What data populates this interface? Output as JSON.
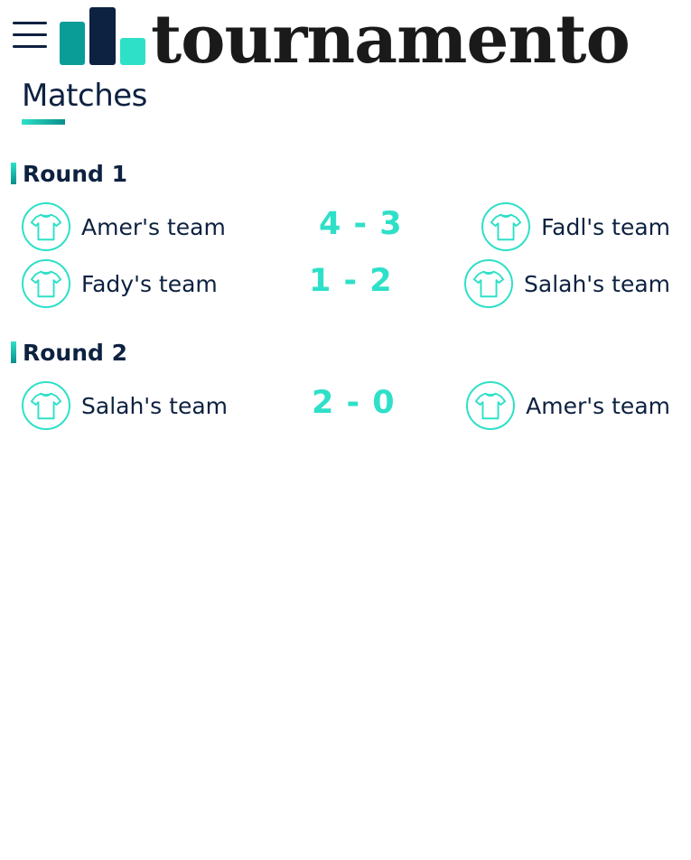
{
  "app": {
    "logo_text": "tournamento",
    "colors": {
      "navy": "#0d2140",
      "teal": "#2ee0c8",
      "dark_teal": "#0a9c97"
    }
  },
  "page": {
    "title": "Matches"
  },
  "rounds": [
    {
      "label": "Round 1",
      "matches": [
        {
          "home": "Amer's team",
          "score": "4 - 3",
          "away": "Fadl's team"
        },
        {
          "home": "Fady's team",
          "score": "1 - 2",
          "away": "Salah's team"
        }
      ]
    },
    {
      "label": "Round 2",
      "matches": [
        {
          "home": "Salah's team",
          "score": "2 - 0",
          "away": "Amer's team"
        }
      ]
    }
  ],
  "icons": {
    "menu": "hamburger-menu-icon",
    "team": "t-shirt-icon"
  }
}
